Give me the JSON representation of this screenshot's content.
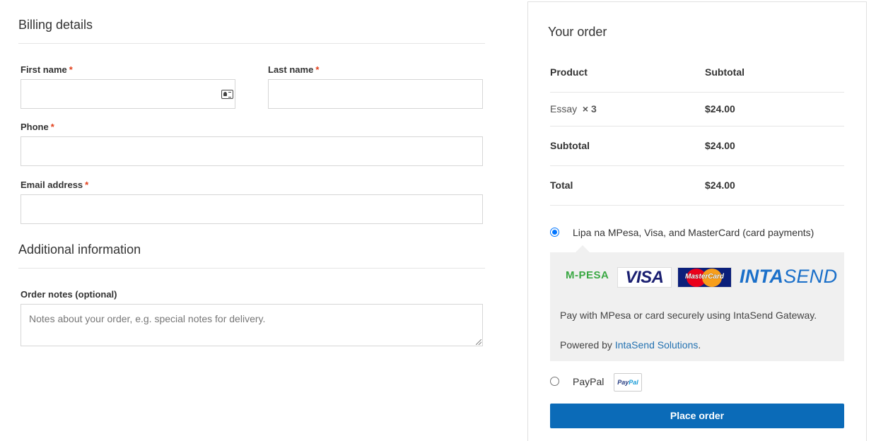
{
  "billing": {
    "title": "Billing details",
    "required_mark": "*",
    "fields": {
      "first_name": {
        "label": "First name",
        "value": ""
      },
      "last_name": {
        "label": "Last name",
        "value": ""
      },
      "phone": {
        "label": "Phone",
        "value": ""
      },
      "email": {
        "label": "Email address",
        "value": ""
      }
    }
  },
  "additional": {
    "title": "Additional information",
    "order_notes": {
      "label": "Order notes (optional)",
      "placeholder": "Notes about your order, e.g. special notes for delivery."
    }
  },
  "order": {
    "title": "Your order",
    "headers": {
      "product": "Product",
      "subtotal": "Subtotal"
    },
    "items": [
      {
        "name": "Essay",
        "qty": "× 3",
        "subtotal": "$24.00"
      }
    ],
    "subtotal_label": "Subtotal",
    "subtotal_value": "$24.00",
    "total_label": "Total",
    "total_value": "$24.00"
  },
  "payment": {
    "methods": [
      {
        "label": "Lipa na MPesa, Visa, and MasterCard (card payments)",
        "selected": true,
        "logos": {
          "mpesa": "M-PESA",
          "visa": "VISA",
          "mastercard": "MasterCard",
          "intasend_bold": "INTA",
          "intasend_rest": "SEND"
        },
        "description": "Pay with MPesa or card securely using IntaSend Gateway.",
        "powered_prefix": "Powered by ",
        "powered_link": "IntaSend Solutions",
        "powered_suffix": "."
      },
      {
        "label": "PayPal",
        "selected": false,
        "badge_pay": "Pay",
        "badge_pal": "Pal"
      }
    ],
    "place_order": "Place order"
  },
  "colors": {
    "accent": "#0b6bb8",
    "required": "#e2401c",
    "link": "#2271b1",
    "radio": "#0075ff"
  }
}
